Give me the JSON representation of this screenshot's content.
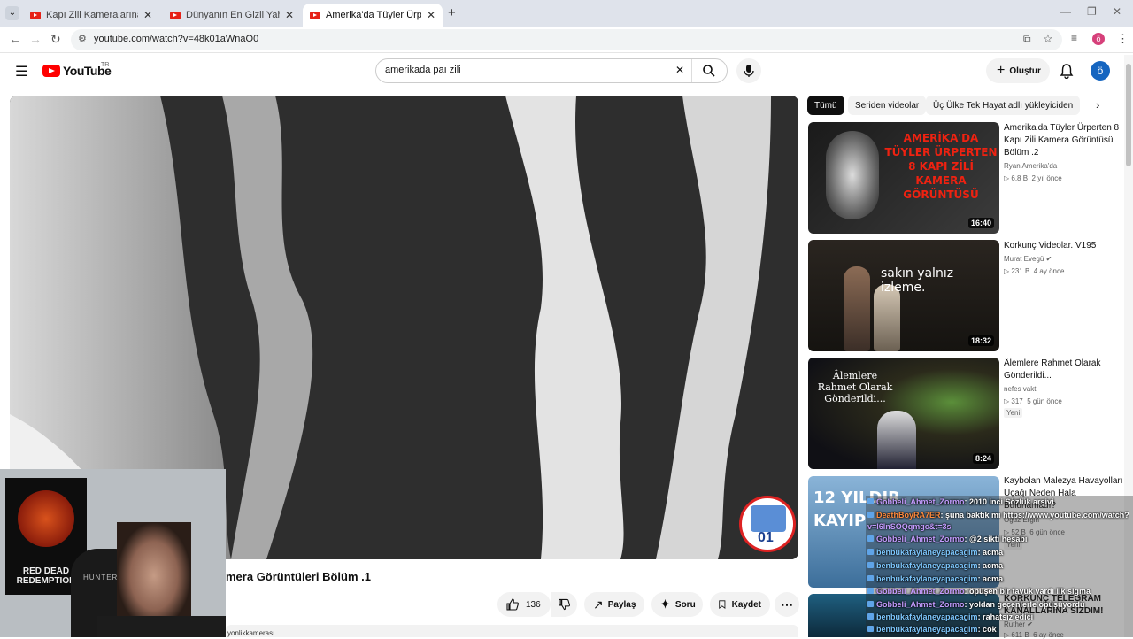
{
  "browser": {
    "tabs": [
      {
        "title": "Kapı Zili Kameralarına Yansıyan"
      },
      {
        "title": "Dünyanın En Gizli Yahudi Toplu"
      },
      {
        "title": "Amerika'da Tüyler Ürperten Ka"
      }
    ],
    "url": "youtube.com/watch?v=48k01aWnaO0",
    "avatar_letter": "ö"
  },
  "header": {
    "logo_text": "YouTube",
    "country": "TR",
    "search_value": "amerikada paı zili",
    "create_label": "Oluştur",
    "avatar_letter": "ö"
  },
  "video": {
    "title_visible": "mera Görüntüleri Bölüm .1",
    "channel_badge_text": "01",
    "like_count": "136",
    "share_label": "Paylaş",
    "ask_label": "Soru",
    "save_label": "Kaydet",
    "description_snippet": "yonlikkamerası"
  },
  "chips": [
    {
      "label": "Tümü",
      "selected": true
    },
    {
      "label": "Seriden videolar",
      "selected": false
    },
    {
      "label": "Üç Ülke Tek Hayat adlı yükleyiciden",
      "selected": false
    }
  ],
  "recommendations": [
    {
      "title": "Amerika'da Tüyler Ürperten 8 Kapı Zili Kamera Görüntüsü Bölüm .2",
      "channel": "Ryan Amerika'da",
      "views": "6,8 B",
      "age": "2 yıl önce",
      "duration": "16:40",
      "thumb_text": "AMERİKA'DA TÜYLER ÜRPERTEN 8 KAPI ZİLİ KAMERA GÖRÜNTÜSÜ",
      "badge": "",
      "verified": false
    },
    {
      "title": "Korkunç Videolar. V195",
      "channel": "Murat Evegü",
      "views": "231 B",
      "age": "4 ay önce",
      "duration": "18:32",
      "thumb_text": "sakın yalnız izleme.",
      "badge": "",
      "verified": true
    },
    {
      "title": "Âlemlere Rahmet Olarak Gönderildi...",
      "channel": "nefes vakti",
      "views": "317",
      "age": "5 gün önce",
      "duration": "8:24",
      "thumb_text": "Âlemlere Rahmet Olarak Gönderildi...",
      "badge": "Yeni",
      "verified": false
    },
    {
      "title": "Kaybolan Malezya Havayolları Uçağı Neden Hala Bulunamadı?",
      "channel": "Oğuz Ergin",
      "views": "52 B",
      "age": "6 gün önce",
      "duration": "",
      "thumb_text": "12 YILDIR KAYIP",
      "badge": "Yeni",
      "verified": false
    },
    {
      "title": "KORKUNÇ TELEGRAM KANALLARINA SIZDIM!",
      "channel": "Ruther",
      "views": "611 B",
      "age": "6 ay önce",
      "duration": "",
      "thumb_text": "",
      "badge": "",
      "verified": true
    }
  ],
  "webcam": {
    "poster_text": "RED DEAD REDEMPTION",
    "chair_text": "HUNTER"
  },
  "chat": [
    {
      "user": "Gobbeli_Ahmet_Zormo",
      "msg": ": 2010 inci Sözlük arşivi"
    },
    {
      "user": "DeathBoyRA7ER",
      "msg": ": şuna baktık mı https://www.youtube.com/watch?"
    },
    {
      "user": "",
      "msg": "v=l6lnSOQqmgc&t=3s"
    },
    {
      "user": "Gobbeli_Ahmet_Zormo",
      "msg": ": @2 sikti hesabı"
    },
    {
      "user": "benbukafaylaneyapacagim",
      "msg": ": acma"
    },
    {
      "user": "benbukafaylaneyapacagim",
      "msg": ": acma"
    },
    {
      "user": "benbukafaylaneyapacagim",
      "msg": ": acma"
    },
    {
      "user": "Gobbeli_Ahmet_Zormo",
      "msg": ": öpüşen bir tavuk vardı ilk sigma"
    },
    {
      "user": "Gobbeli_Ahmet_Zormo",
      "msg": ": yoldan geçenlerle öpüşüyordu"
    },
    {
      "user": "benbukafaylaneyapacagim",
      "msg": ": rahatsız edici"
    },
    {
      "user": "benbukafaylaneyapacagim",
      "msg": ": cok"
    }
  ]
}
